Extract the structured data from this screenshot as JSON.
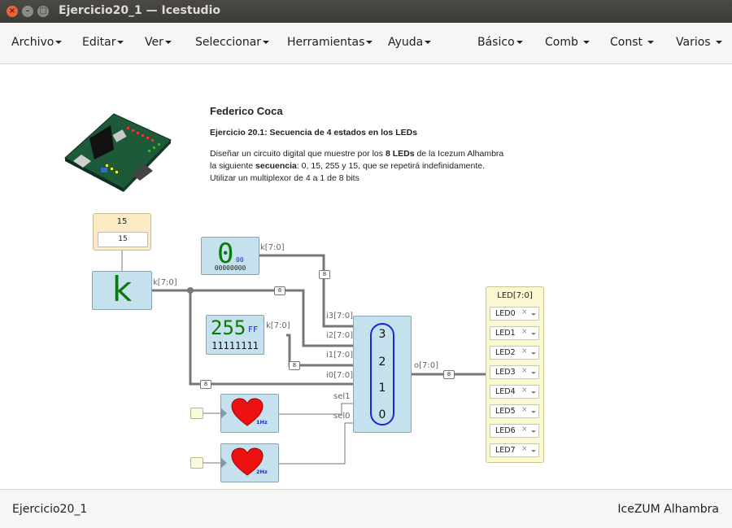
{
  "window": {
    "title": "Ejercicio20_1 — Icestudio",
    "buttons": [
      "close",
      "minimize",
      "maximize"
    ]
  },
  "menubar": {
    "left": [
      {
        "label": "Archivo"
      },
      {
        "label": "Editar"
      },
      {
        "label": "Ver"
      },
      {
        "label": "Seleccionar"
      },
      {
        "label": "Herramientas"
      },
      {
        "label": "Ayuda"
      }
    ],
    "right": [
      {
        "label": "Básico"
      },
      {
        "label": "Comb"
      },
      {
        "label": "Const"
      },
      {
        "label": "Varios"
      }
    ]
  },
  "info": {
    "author": "Federico Coca",
    "exercise": "Ejercicio 20.1: Secuencia de 4 estados en los LEDs",
    "line1_a": "Diseñar un circuito digital que muestre por los ",
    "line1_b": "8 LEDs",
    "line1_c": " de la Icezum Alhambra",
    "line2_a": "la siguiente ",
    "line2_b": "secuencia",
    "line2_c": ": 0, 15, 255 y 15, que se repetirá indefinidamente.",
    "line3": "Utilizar un multiplexor de 4 a 1 de 8 bits"
  },
  "circuit": {
    "param": {
      "label": "15",
      "value": "15"
    },
    "const_k": {
      "symbol": "k",
      "wire": "k[7:0]"
    },
    "const_0": {
      "value": "0",
      "hex": "00",
      "bin": "00000000",
      "wire": "k[7:0]"
    },
    "const_255": {
      "value": "255",
      "hex": "FF",
      "bin": "11111111",
      "wire": "k[7:0]"
    },
    "mux": {
      "inputs": [
        "i3[7:0]",
        "i2[7:0]",
        "i1[7:0]",
        "i0[7:0]",
        "sel1",
        "sel0"
      ],
      "output": "o[7:0]",
      "states": [
        "3",
        "2",
        "1",
        "0"
      ]
    },
    "bus_width": "8",
    "clock_1hz": "1Hz",
    "clock_2hz": "2Hz",
    "leds": {
      "title": "LED[7:0]",
      "items": [
        "LED0",
        "LED1",
        "LED2",
        "LED3",
        "LED4",
        "LED5",
        "LED6",
        "LED7"
      ],
      "remove_glyph": "×"
    }
  },
  "statusbar": {
    "left": "Ejercicio20_1",
    "right": "IceZUM Alhambra"
  },
  "colors": {
    "block_fill": "#c5e1ee",
    "wire": "#777777",
    "heart": "#ee1111",
    "const_green": "#0a7a0a",
    "mux_ring": "#1a26d6",
    "led_panel": "#fbf7d0"
  }
}
